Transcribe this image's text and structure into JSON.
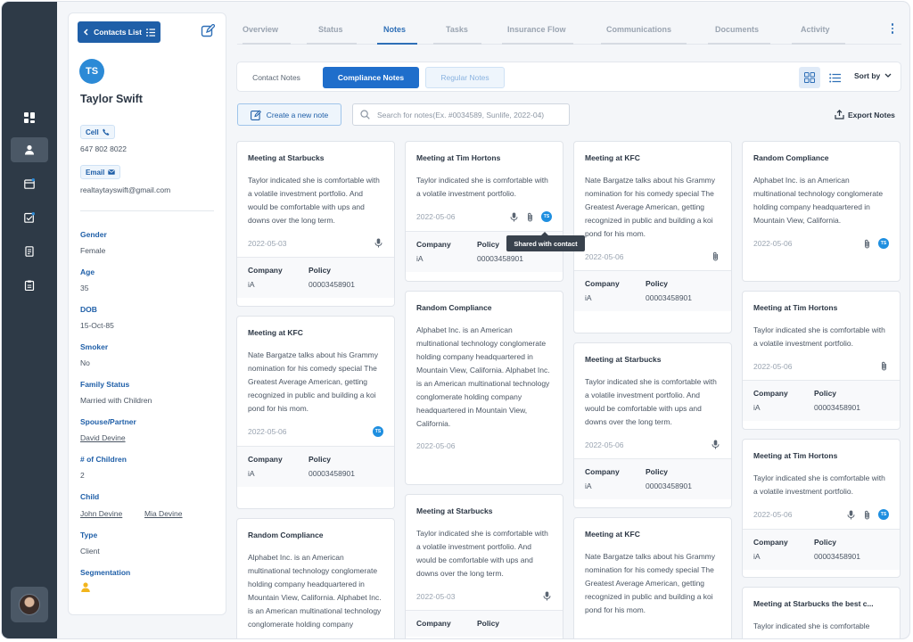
{
  "sidebar": {
    "items": [
      {
        "icon": "dashboard-icon"
      },
      {
        "icon": "contacts-icon",
        "active": true
      },
      {
        "icon": "calendar-icon"
      },
      {
        "icon": "tasks-icon"
      },
      {
        "icon": "policy-icon"
      },
      {
        "icon": "clipboard-icon"
      }
    ],
    "user_avatar": "user-avatar"
  },
  "profile": {
    "back_button": "Contacts List",
    "initials": "TS",
    "name": "Taylor Swift",
    "cell_label": "Cell",
    "phone": "647 802 8022",
    "email_label": "Email",
    "email": "realtaytayswift@gmail.com",
    "fields": {
      "gender": {
        "label": "Gender",
        "value": "Female"
      },
      "age": {
        "label": "Age",
        "value": "35"
      },
      "dob": {
        "label": "DOB",
        "value": "15-Oct-85"
      },
      "smoker": {
        "label": "Smoker",
        "value": "No"
      },
      "family_status": {
        "label": "Family Status",
        "value": "Married with Children"
      },
      "spouse": {
        "label": "Spouse/Partner",
        "value": "David Devine"
      },
      "children_count": {
        "label": "# of Children",
        "value": "2"
      },
      "child": {
        "label": "Child",
        "values": [
          "John Devine",
          "Mia Devine"
        ]
      },
      "type": {
        "label": "Type",
        "value": "Client"
      },
      "segmentation": {
        "label": "Segmentation"
      }
    }
  },
  "tabs": [
    "Overview",
    "Status",
    "Notes",
    "Tasks",
    "Insurance Flow",
    "Communications",
    "Documents",
    "Activity"
  ],
  "active_tab": "Notes",
  "note_types": {
    "contact": "Contact Notes",
    "compliance": "Compliance Notes",
    "regular": "Regular Notes"
  },
  "sort_label": "Sort by",
  "create_button": "Create a new note",
  "search": {
    "placeholder": "Search for notes(Ex. #0034589, Sunlife, 2022-04)",
    "value": ""
  },
  "export_label": "Export Notes",
  "tooltip": "Shared with contact",
  "footer_labels": {
    "company": "Company",
    "policy": "Policy"
  },
  "notes": {
    "c1": [
      {
        "title": "Meeting at Starbucks",
        "body": "Taylor indicated she is comfortable with a volatile investment portfolio. And would be comfortable with ups and downs over the long term.",
        "date": "2022-05-03",
        "company": "iA",
        "policy": "00003458901"
      },
      {
        "title": "Meeting at KFC",
        "body": "Nate Bargatze talks about his Grammy nomination for his comedy special The Greatest Average American, getting recognized in public and building a koi pond for his mom.",
        "date": "2022-05-06",
        "company": "iA",
        "policy": "00003458901"
      },
      {
        "title": "Random Compliance",
        "body": "Alphabet Inc. is an American multinational technology conglomerate holding company headquartered in Mountain View, California. Alphabet Inc. is an American multinational technology conglomerate holding company"
      }
    ],
    "c2": [
      {
        "title": "Meeting at Tim Hortons",
        "body": "Taylor indicated she is comfortable with a volatile investment portfolio.",
        "date": "2022-05-06",
        "company": "iA",
        "policy": "00003458901"
      },
      {
        "title": "Random Compliance",
        "body": "Alphabet Inc. is an American multinational technology conglomerate holding company headquartered in Mountain View, California. Alphabet Inc. is an American multinational technology conglomerate holding company headquartered in Mountain View, California.",
        "date": "2022-05-06"
      },
      {
        "title": "Meeting at Starbucks",
        "body": "Taylor indicated she is comfortable with a volatile investment portfolio. And would be comfortable with ups and downs over the long term.",
        "date": "2022-05-03",
        "company": "Company"
      }
    ],
    "c3": [
      {
        "title": "Meeting at KFC",
        "body": "Nate Bargatze talks about his Grammy nomination for his comedy special The Greatest Average American, getting recognized in public and building a koi pond for his mom.",
        "date": "2022-05-06",
        "company": "iA",
        "policy": "00003458901"
      },
      {
        "title": "Meeting at Starbucks",
        "body": "Taylor indicated she is comfortable with a volatile investment portfolio. And would be comfortable with ups and downs over the long term.",
        "date": "2022-05-06",
        "company": "iA",
        "policy": "00003458901"
      },
      {
        "title": "Meeting at KFC",
        "body": "Nate Bargatze talks about his Grammy nomination for his comedy special The Greatest Average American, getting recognized in public and building a koi pond for his mom."
      }
    ],
    "c4": [
      {
        "title": "Random Compliance",
        "body": "Alphabet Inc. is an American multinational technology conglomerate holding company headquartered in Mountain View, California.",
        "date": "2022-05-06"
      },
      {
        "title": "Meeting at Tim Hortons",
        "body": "Taylor indicated she is comfortable with a volatile investment portfolio.",
        "date": "2022-05-06",
        "company": "iA",
        "policy": "00003458901"
      },
      {
        "title": "Meeting at Tim Hortons",
        "body": "Taylor indicated she is comfortable with a volatile investment portfolio.",
        "date": "2022-05-06",
        "company": "iA",
        "policy": "00003458901"
      },
      {
        "title": "Meeting at Starbucks the best c...",
        "body": "Taylor indicated she is comfortable"
      }
    ]
  },
  "colors": {
    "primary": "#1f6ecb",
    "brand_dark": "#1f5fa8",
    "rail": "#2e3a47",
    "badge": "#1f8fe0"
  }
}
